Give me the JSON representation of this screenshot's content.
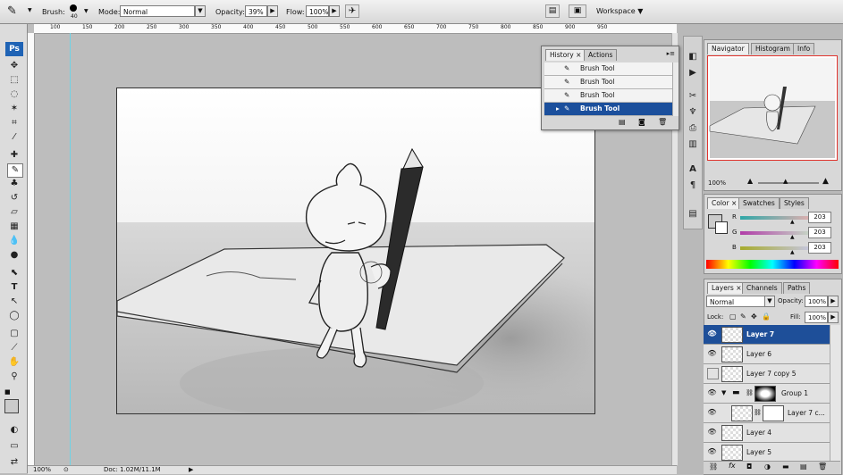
{
  "options_bar": {
    "brush_label": "Brush:",
    "brush_size": "40",
    "mode_label": "Mode:",
    "mode_value": "Normal",
    "opacity_label": "Opacity:",
    "opacity_value": "39%",
    "flow_label": "Flow:",
    "flow_value": "100%",
    "workspace_label": "Workspace ▼"
  },
  "ruler": {
    "marks": [
      "100",
      "150",
      "200",
      "250",
      "300",
      "350",
      "400",
      "450",
      "500",
      "550",
      "600",
      "650",
      "700",
      "750",
      "800",
      "850",
      "900",
      "950"
    ]
  },
  "status": {
    "zoom": "100%",
    "doc": "Doc: 1.02M/11.1M"
  },
  "history": {
    "tabs": [
      "History",
      "Actions"
    ],
    "items": [
      "Brush Tool",
      "Brush Tool",
      "Brush Tool",
      "Brush Tool"
    ]
  },
  "navigator": {
    "tabs": [
      "Navigator",
      "Histogram",
      "Info"
    ],
    "zoom": "100%"
  },
  "color": {
    "tabs": [
      "Color",
      "Swatches",
      "Styles"
    ],
    "r_label": "R",
    "g_label": "G",
    "b_label": "B",
    "r_value": "203",
    "g_value": "203",
    "b_value": "203"
  },
  "layers_panel": {
    "tabs": [
      "Layers",
      "Channels",
      "Paths"
    ],
    "blend_mode": "Normal",
    "opacity_label": "Opacity:",
    "opacity_value": "100%",
    "lock_label": "Lock:",
    "fill_label": "Fill:",
    "fill_value": "100%",
    "layers": [
      "Layer 7",
      "Layer 6",
      "Layer 7 copy 5",
      "Group 1",
      "Layer 7 c...",
      "Layer 4",
      "Layer 5"
    ]
  },
  "app": {
    "logo": "Ps"
  },
  "colors": {
    "selection": "#1e4f99",
    "panel_bg": "#d8d8d8"
  }
}
